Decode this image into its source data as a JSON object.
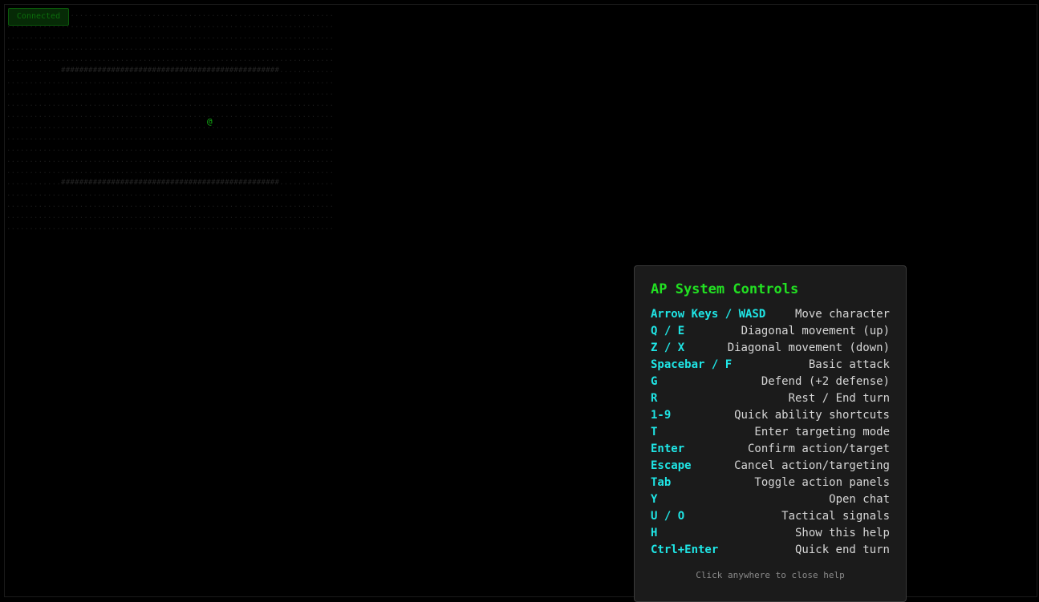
{
  "status": {
    "label": "Connected",
    "color": "#0c6e0c"
  },
  "map": {
    "floor_char": ".",
    "wall_char": "#",
    "player_char": "@",
    "player_color": "#14b214",
    "floor_color": "#1d1d1d",
    "wall_color": "#262626"
  },
  "help": {
    "title": "AP System Controls",
    "controls": [
      {
        "key": "Arrow Keys / WASD",
        "desc": "Move character"
      },
      {
        "key": "Q / E",
        "desc": "Diagonal movement (up)"
      },
      {
        "key": "Z / X",
        "desc": "Diagonal movement (down)"
      },
      {
        "key": "Spacebar / F",
        "desc": "Basic attack"
      },
      {
        "key": "G",
        "desc": "Defend (+2 defense)"
      },
      {
        "key": "R",
        "desc": "Rest / End turn"
      },
      {
        "key": "1-9",
        "desc": "Quick ability shortcuts"
      },
      {
        "key": "T",
        "desc": "Enter targeting mode"
      },
      {
        "key": "Enter",
        "desc": "Confirm action/target"
      },
      {
        "key": "Escape",
        "desc": "Cancel action/targeting"
      },
      {
        "key": "Tab",
        "desc": "Toggle action panels"
      },
      {
        "key": "Y",
        "desc": "Open chat"
      },
      {
        "key": "U / O",
        "desc": "Tactical signals"
      },
      {
        "key": "H",
        "desc": "Show this help"
      },
      {
        "key": "Ctrl+Enter",
        "desc": "Quick end turn"
      }
    ],
    "footer": "Click anywhere to close help",
    "title_color": "#22e022",
    "key_color": "#1fe6e6"
  }
}
